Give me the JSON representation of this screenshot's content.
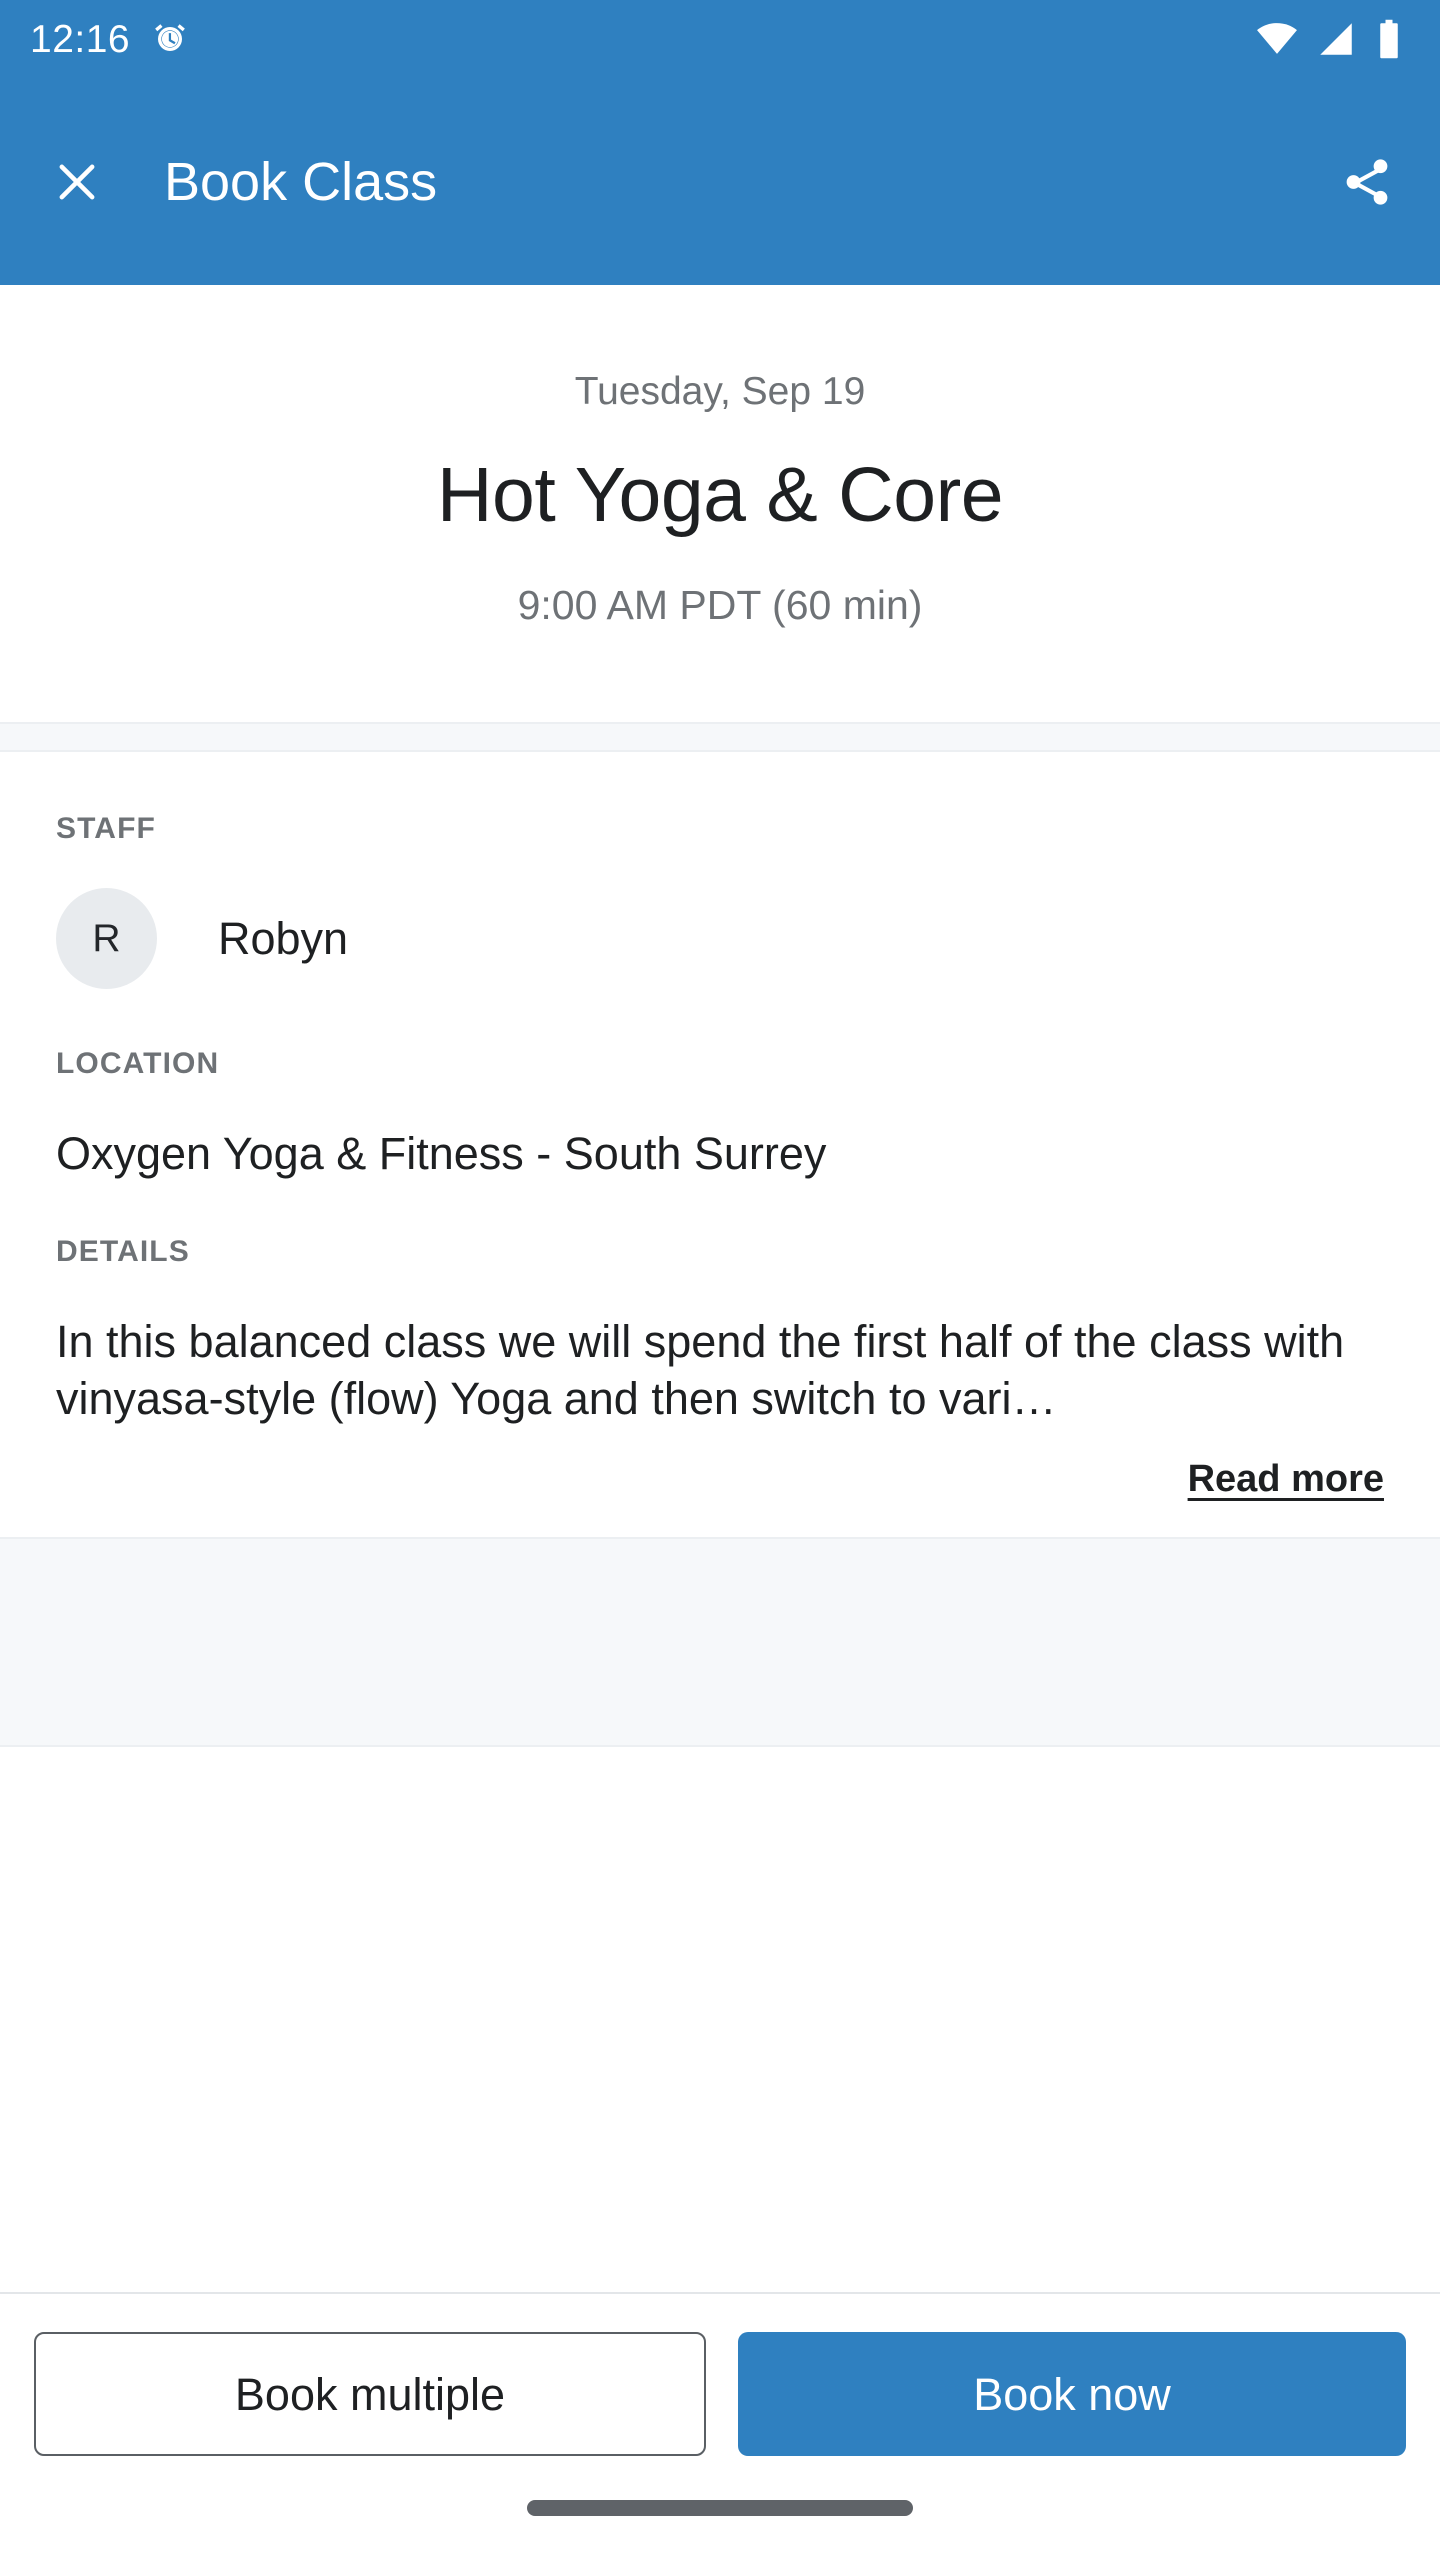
{
  "status_bar": {
    "clock": "12:16",
    "icons": [
      "alarm-icon",
      "wifi-icon",
      "cellular-signal-icon",
      "battery-icon"
    ]
  },
  "app_bar": {
    "title": "Book Class",
    "close_icon": "close-icon",
    "share_icon": "share-icon",
    "background_color": "#2F80C0"
  },
  "hero": {
    "date": "Tuesday, Sep 19",
    "title": "Hot Yoga & Core",
    "time": "9:00 AM PDT (60 min)"
  },
  "staff": {
    "label": "STAFF",
    "initial": "R",
    "name": "Robyn"
  },
  "location": {
    "label": "LOCATION",
    "value": "Oxygen Yoga & Fitness - South Surrey"
  },
  "details": {
    "label": "DETAILS",
    "text": "In this balanced class we will spend the first half of the class with vinyasa-style (flow) Yoga and then switch to vari…",
    "read_more_label": "Read more"
  },
  "actions": {
    "secondary_label": "Book multiple",
    "primary_label": "Book now",
    "primary_color": "#2F80C0"
  }
}
